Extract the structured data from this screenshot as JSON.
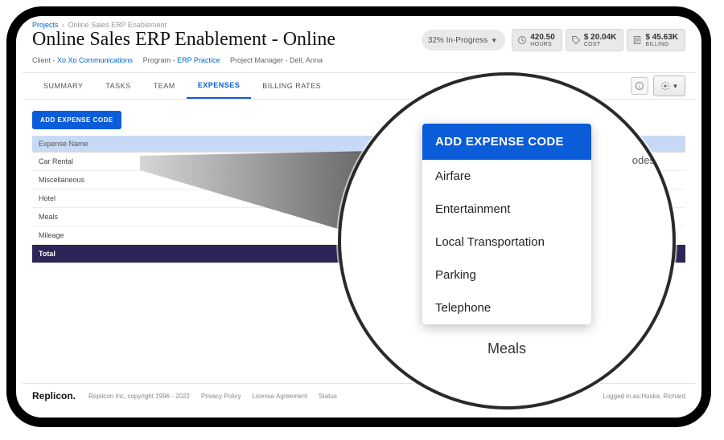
{
  "breadcrumb": {
    "root": "Projects",
    "current": "Online Sales ERP Enablement"
  },
  "page_title": "Online Sales ERP Enablement - Online",
  "progress": {
    "percent": "32%",
    "label": "In-Progress"
  },
  "stats": {
    "hours": {
      "value": "420.50",
      "label": "HOURS"
    },
    "cost": {
      "value": "$ 20.04K",
      "label": "COST"
    },
    "billing": {
      "value": "$ 45.63K",
      "label": "BILLING"
    }
  },
  "meta": {
    "client_label": "Client - ",
    "client": "Xo Xo Communications",
    "program_label": "Program - ",
    "program": "ERP Practice",
    "pm_label": "Project Manager - ",
    "pm": "Dell, Anna"
  },
  "tabs": {
    "summary": "SUMMARY",
    "tasks": "TASKS",
    "team": "TEAM",
    "expenses": "EXPENSES",
    "billing_rates": "BILLING RATES"
  },
  "expenses": {
    "add_label": "ADD EXPENSE CODE",
    "header_name": "Expense Name",
    "rows": [
      "Car Rental",
      "Miscellaneous",
      "Hotel",
      "Meals",
      "Mileage"
    ],
    "total_label": "Total"
  },
  "footer": {
    "brand": "Replicon.",
    "copyright": "Replicon Inc, copyright 1996 - 2022",
    "links": {
      "privacy": "Privacy Policy",
      "license": "License Agreement",
      "status": "Status"
    },
    "logged_in_label": "Logged in as: ",
    "logged_in_user": "Huska, Richard"
  },
  "zoom": {
    "codes_suffix": "odes",
    "header": "ADD EXPENSE CODE",
    "items": [
      "Airfare",
      "Entertainment",
      "Local Transportation",
      "Parking",
      "Telephone"
    ],
    "bg_item": "Meals"
  }
}
